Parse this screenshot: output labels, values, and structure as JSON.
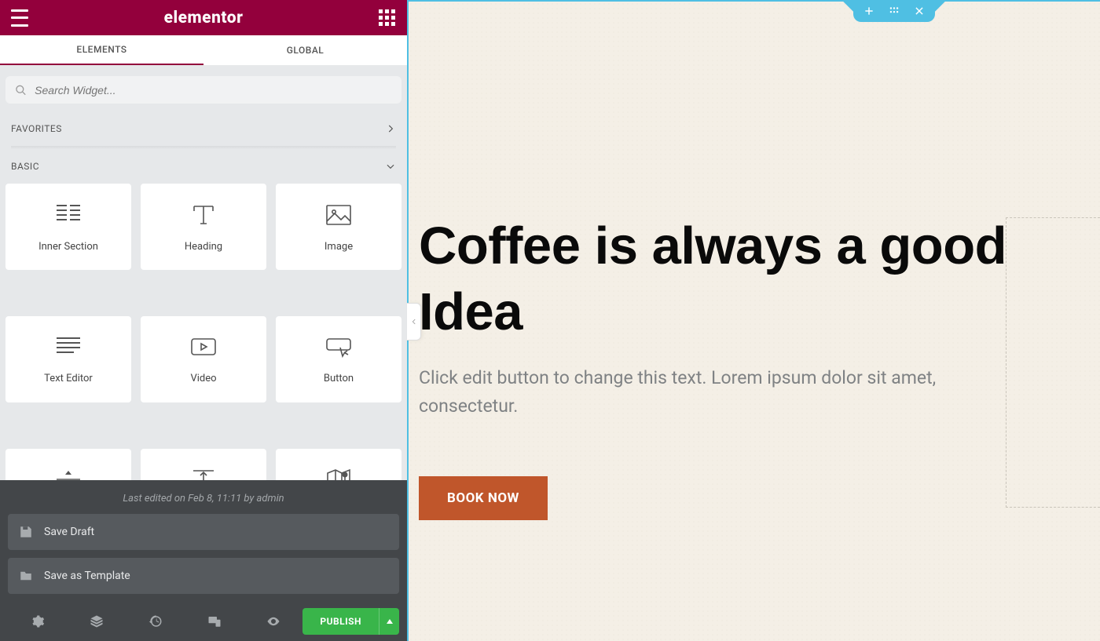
{
  "brand": "elementor",
  "tabs": {
    "elements": "ELEMENTS",
    "global": "GLOBAL"
  },
  "search": {
    "placeholder": "Search Widget..."
  },
  "sections": {
    "favorites": "FAVORITES",
    "basic": "BASIC"
  },
  "widgets": {
    "inner_section": "Inner Section",
    "heading": "Heading",
    "image": "Image",
    "text_editor": "Text Editor",
    "video": "Video",
    "button": "Button",
    "divider": "Divider",
    "spacer": "Spacer",
    "google_maps": "Google Maps"
  },
  "save": {
    "last_edited": "Last edited on Feb 8, 11:11 by admin",
    "draft": "Save Draft",
    "template": "Save as Template"
  },
  "publish": "PUBLISH",
  "canvas": {
    "heading": "Coffee is always a good Idea",
    "paragraph": "Click edit button to change this text. Lorem ipsum dolor sit amet, consectetur.",
    "button": "BOOK NOW"
  },
  "colors": {
    "brand": "#93003c",
    "accent": "#4fbfe3",
    "publish": "#39b54a",
    "cta": "#c0562b"
  }
}
